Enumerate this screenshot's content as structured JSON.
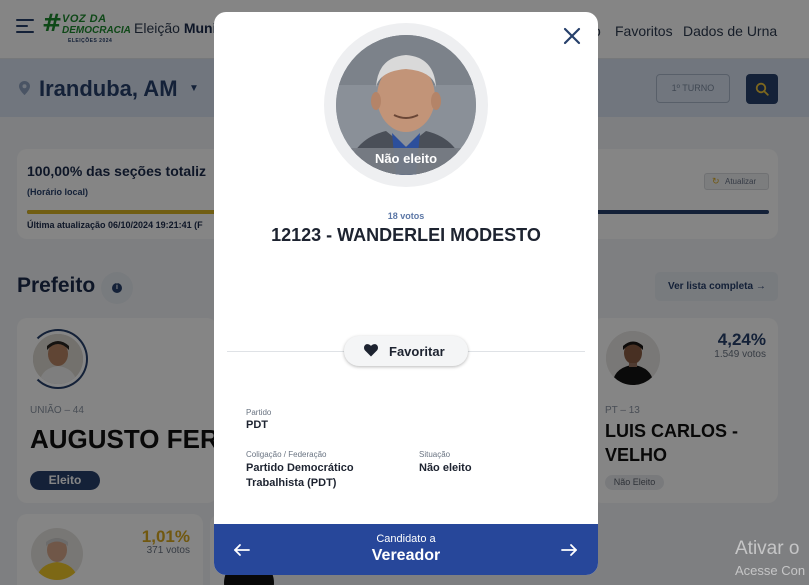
{
  "header": {
    "logo_hash": "#",
    "logo_line1": "VOZ DA",
    "logo_line2": "DEMOCRACIA",
    "logo_line3": "ELEIÇÕES 2024",
    "eleicao_prefix": "Eleição",
    "eleicao_bold": "Munic",
    "nav_partial": "o",
    "nav_favoritos": "Favoritos",
    "nav_dados": "Dados de Urna"
  },
  "location": {
    "city": "Iranduba, AM",
    "turno_label": "1º TURNO"
  },
  "status": {
    "title": "100,00% das seções totaliz",
    "subtitle": "(Horário local)",
    "last_update": "Última atualização 06/10/2024 19:21:41 (F",
    "refresh_label": "Atualizar",
    "progress_pct": 100,
    "colors": {
      "fill": "#d8b525",
      "track": "#27406b"
    }
  },
  "prefeito": {
    "section_title": "Prefeito",
    "ver_lista": "Ver lista completa",
    "left_card": {
      "party": "UNIÃO – 44",
      "name": "AUGUSTO FERI",
      "badge": "Eleito"
    },
    "right_card": {
      "pct": "4,24%",
      "votes": "1.549 votos",
      "party": "PT – 13",
      "name_line1": "LUIS CARLOS -",
      "name_line2": "VELHO",
      "badge": "Não Eleito"
    },
    "bottom_card": {
      "pct": "1,01%",
      "votes": "371 votos"
    }
  },
  "windows_watermark": {
    "line1": "Ativar o",
    "line2": "Acesse Con"
  },
  "modal": {
    "photo_status": "Não eleito",
    "votes": "18 votos",
    "candidate": "12123 - WANDERLEI MODESTO",
    "favoritar": "Favoritar",
    "partido_label": "Partido",
    "partido_value": "PDT",
    "coligacao_label": "Coligação / Federação",
    "coligacao_line1": "Partido Democrático",
    "coligacao_line2": "Trabalhista (PDT)",
    "situacao_label": "Situação",
    "situacao_value": "Não eleito",
    "footer_sub": "Candidato a",
    "footer_main": "Vereador",
    "icons": {
      "close": "close-icon",
      "heart": "heart-icon",
      "prev": "arrow-left-icon",
      "next": "arrow-right-icon"
    },
    "colors": {
      "footer": "#27479a",
      "accent": "#27406b"
    }
  }
}
